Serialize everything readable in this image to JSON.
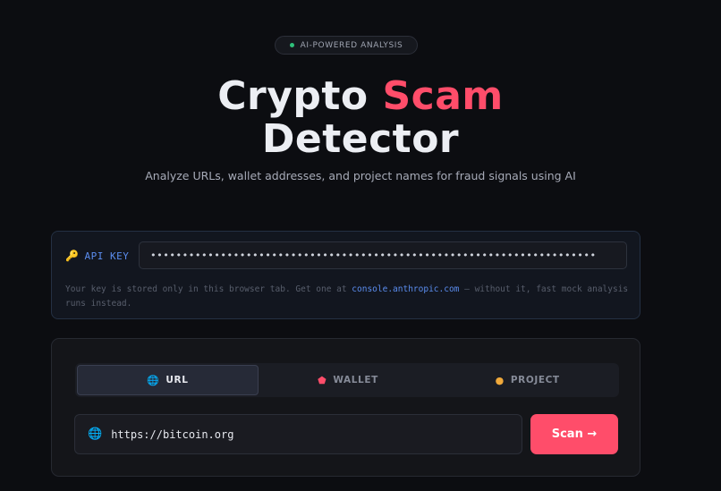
{
  "badge": {
    "text": "AI-POWERED ANALYSIS"
  },
  "hero": {
    "title_part1": "Crypto ",
    "title_accent": "Scam",
    "title_line2": "Detector",
    "subtitle": "Analyze URLs, wallet addresses, and project names for fraud signals using AI"
  },
  "api": {
    "label": "API KEY",
    "key_masked": "••••••••••••••••••••••••••••••••••••••••••••••••••••••••••••••••••••••",
    "note_before": "Your key is stored only in this browser tab. Get one at ",
    "note_link": "console.anthropic.com",
    "note_after": " — without it, fast mock analysis runs instead."
  },
  "scan": {
    "tabs": [
      {
        "label": "URL",
        "icon": "globe-icon",
        "glyph": "🌐",
        "active": true
      },
      {
        "label": "WALLET",
        "icon": "gem-icon",
        "glyph": "⬟",
        "active": false
      },
      {
        "label": "PROJECT",
        "icon": "coin-icon",
        "glyph": "●",
        "active": false
      }
    ],
    "input_value": "https://bitcoin.org",
    "button_label": "Scan →"
  },
  "colors": {
    "accent": "#ff4d6a",
    "link": "#5b8def",
    "status_dot": "#2fc07a",
    "wallet_icon": "#ff4d6a",
    "project_icon": "#f0a93b"
  }
}
